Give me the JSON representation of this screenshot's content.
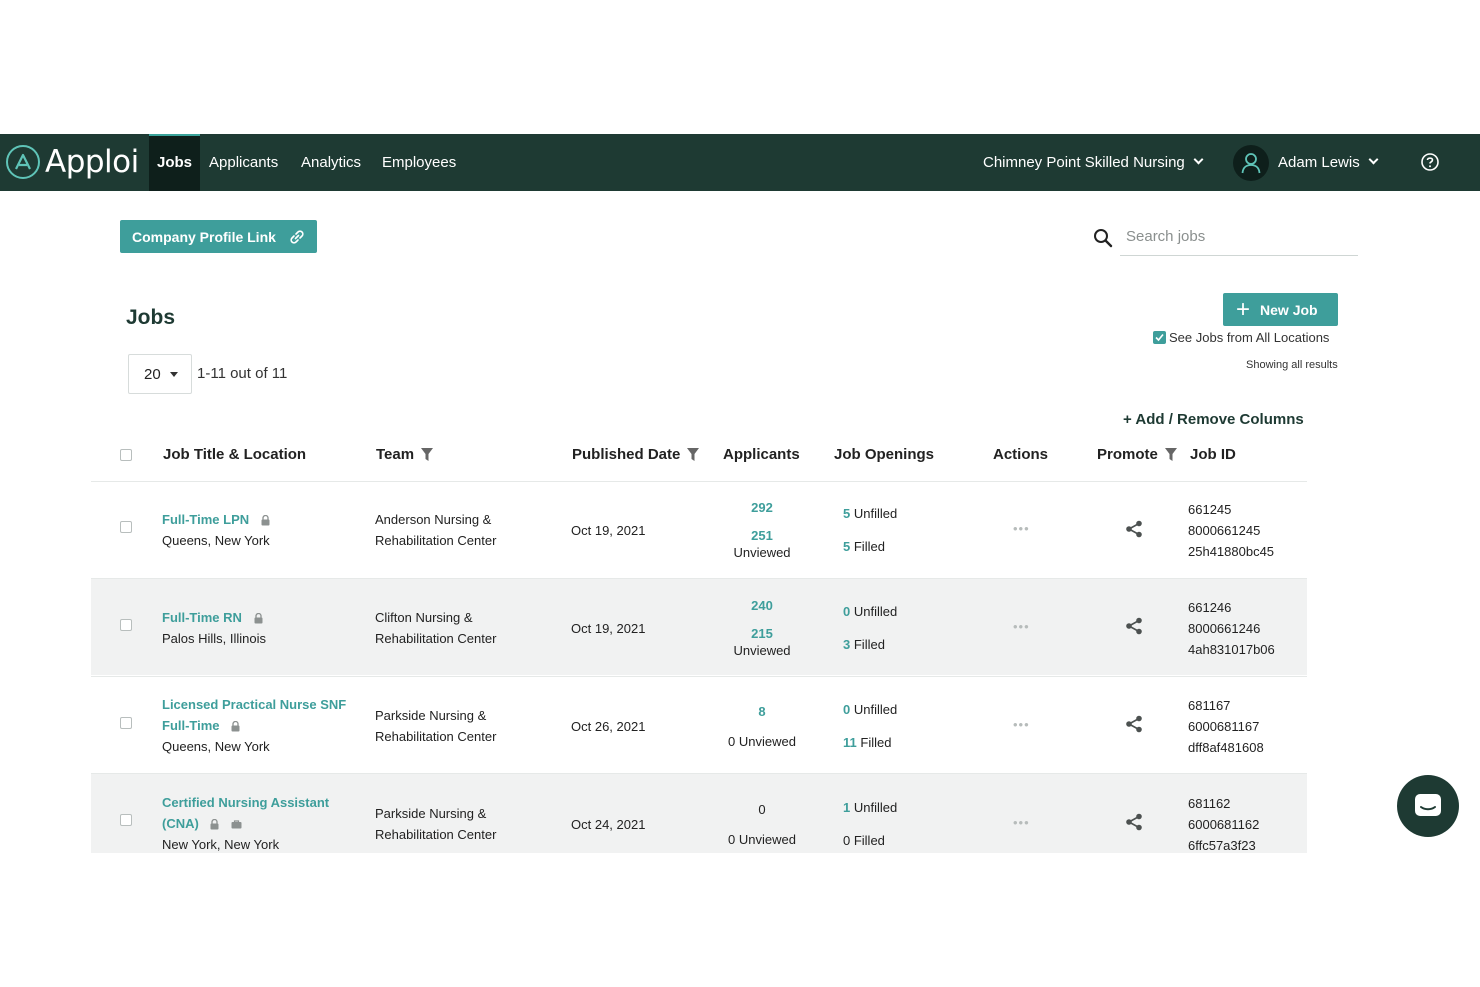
{
  "app": {
    "name": "Apploi"
  },
  "nav": {
    "tabs": [
      {
        "label": "Jobs",
        "active": true
      },
      {
        "label": "Applicants",
        "active": false
      },
      {
        "label": "Analytics",
        "active": false
      },
      {
        "label": "Employees",
        "active": false
      }
    ],
    "company": "Chimney Point Skilled Nursing",
    "user": "Adam Lewis"
  },
  "toolbar": {
    "company_profile_link": "Company Profile Link",
    "search_placeholder": "Search jobs"
  },
  "page": {
    "title": "Jobs",
    "new_job": "New Job",
    "see_all_locations": "See Jobs from All Locations",
    "see_all_locations_checked": true,
    "showing": "Showing all results",
    "per_page": "20",
    "range": "1-11 out of 11",
    "add_remove_columns": "+ Add / Remove Columns"
  },
  "table": {
    "headers": {
      "title_location": "Job Title & Location",
      "team": "Team",
      "published": "Published Date",
      "applicants": "Applicants",
      "openings": "Job Openings",
      "actions": "Actions",
      "promote": "Promote",
      "job_id": "Job ID"
    },
    "rows": [
      {
        "title_lines": [
          "Full-Time LPN"
        ],
        "location": "Queens, New York",
        "team": [
          "Anderson Nursing &",
          "Rehabilitation Center"
        ],
        "published": "Oct 19, 2021",
        "applicants_total": "292",
        "unviewed_count": "251",
        "unviewed_label": "Unviewed",
        "unfilled_count": "5",
        "unfilled_label": "Unfilled",
        "filled_count": "5",
        "filled_label": "Filled",
        "ids": [
          "661245",
          "8000661245",
          "25h41880bc45"
        ]
      },
      {
        "title_lines": [
          "Full-Time RN"
        ],
        "location": "Palos Hills, Illinois",
        "team": [
          "Clifton Nursing &",
          "Rehabilitation Center"
        ],
        "published": "Oct 19, 2021",
        "applicants_total": "240",
        "unviewed_count": "215",
        "unviewed_label": "Unviewed",
        "unfilled_count": "0",
        "unfilled_label": "Unfilled",
        "filled_count": "3",
        "filled_label": "Filled",
        "ids": [
          "661246",
          "8000661246",
          "4ah831017b06"
        ]
      },
      {
        "title_lines": [
          "Licensed Practical Nurse SNF",
          "Full-Time"
        ],
        "location": "Queens, New York",
        "team": [
          "Parkside Nursing &",
          "Rehabilitation Center"
        ],
        "published": "Oct 26, 2021",
        "applicants_total": "8",
        "unviewed_text": "0 Unviewed",
        "unfilled_count": "0",
        "unfilled_label": "Unfilled",
        "filled_count": "11",
        "filled_label": "Filled",
        "ids": [
          "681167",
          "6000681167",
          "dff8af481608"
        ]
      },
      {
        "title_lines": [
          "Certified Nursing Assistant",
          "(CNA)"
        ],
        "location": "New York, New York",
        "team": [
          "Parkside Nursing &",
          "Rehabilitation Center"
        ],
        "published": "Oct 24, 2021",
        "applicants_total": "0",
        "unviewed_text": "0 Unviewed",
        "unfilled_count": "1",
        "unfilled_label": "Unfilled",
        "filled_text": "0 Filled",
        "ids": [
          "681162",
          "6000681162",
          "6ffc57a3f23"
        ]
      }
    ]
  }
}
